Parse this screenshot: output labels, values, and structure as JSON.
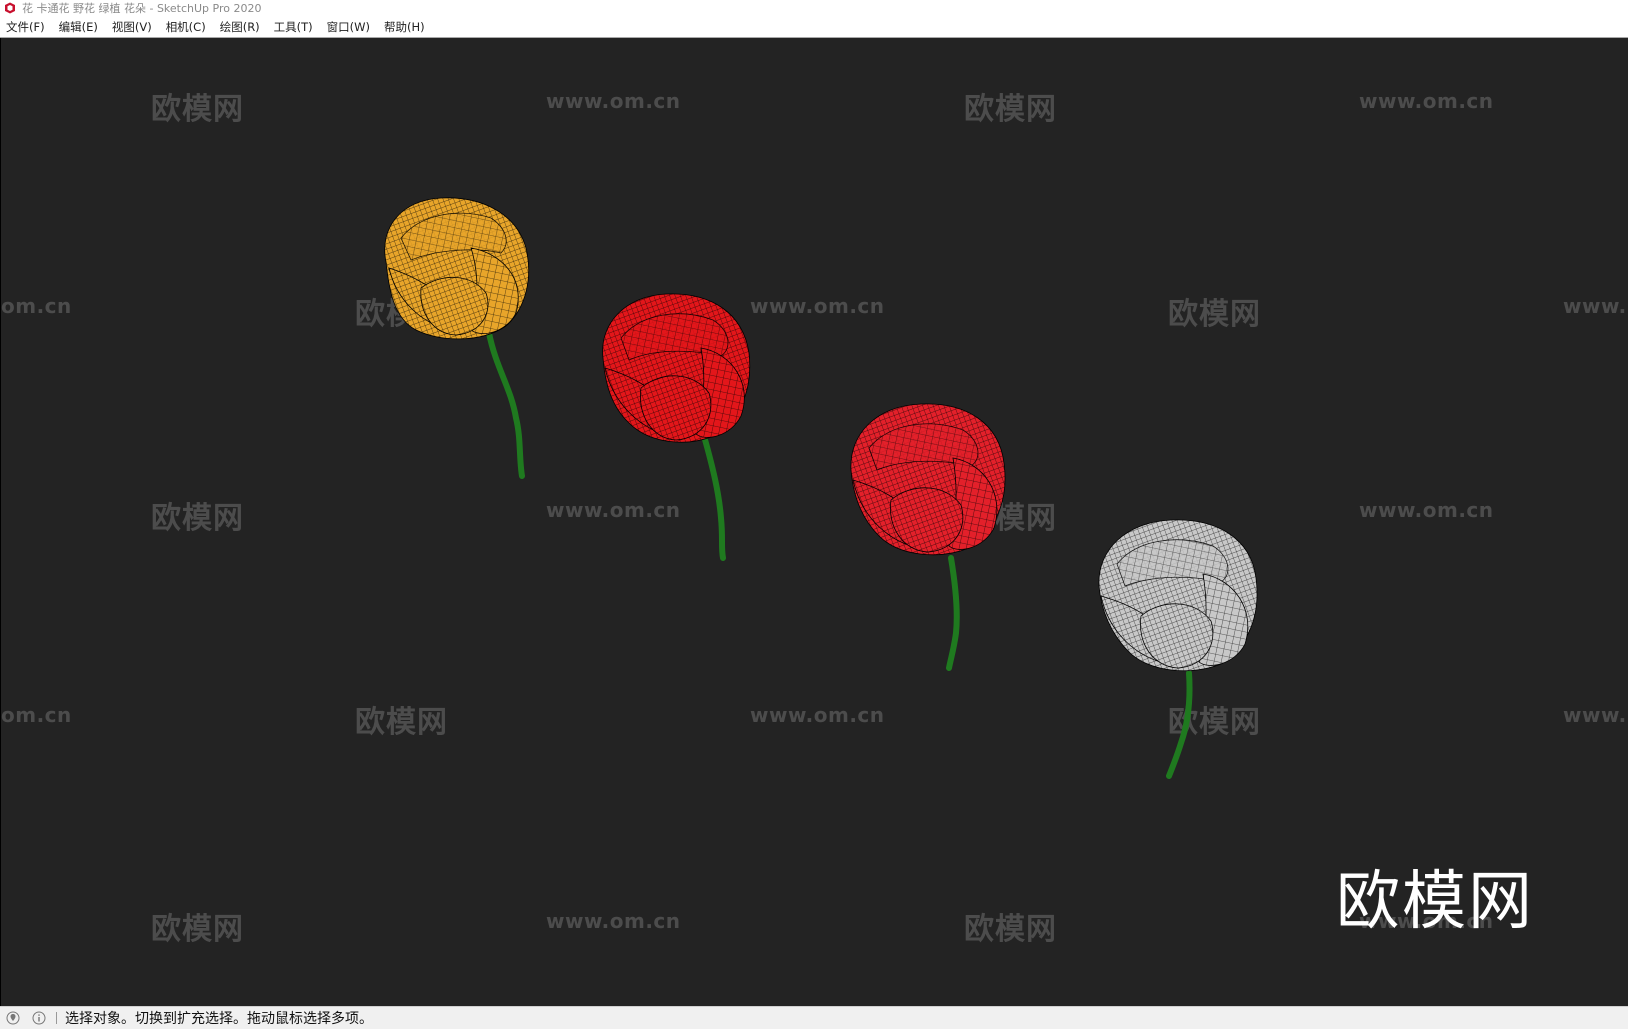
{
  "window": {
    "title": "花 卡通花 野花 绿植 花朵 - SketchUp Pro 2020"
  },
  "menu": [
    {
      "label": "文件(F)"
    },
    {
      "label": "编辑(E)"
    },
    {
      "label": "视图(V)"
    },
    {
      "label": "相机(C)"
    },
    {
      "label": "绘图(R)"
    },
    {
      "label": "工具(T)"
    },
    {
      "label": "窗口(W)"
    },
    {
      "label": "帮助(H)"
    }
  ],
  "viewport": {
    "background": "#232323",
    "watermark_cn": "欧模网",
    "watermark_url": "www.om.cn",
    "watermark_url_cut": "om.cn",
    "watermark_url_tail": "www.",
    "logo": "欧模网",
    "models": [
      {
        "name": "yellow-tulip",
        "color": "#e8a52a"
      },
      {
        "name": "red-tulip",
        "color": "#e3161a"
      },
      {
        "name": "red-tulip",
        "color": "#e3202a"
      },
      {
        "name": "white-tulip",
        "color": "#c8c8c8"
      }
    ],
    "stem_color": "#1f7a1f"
  },
  "status": {
    "icons": [
      "geolocation-icon",
      "info-icon"
    ],
    "text": "选择对象。切换到扩充选择。拖动鼠标选择多项。"
  }
}
